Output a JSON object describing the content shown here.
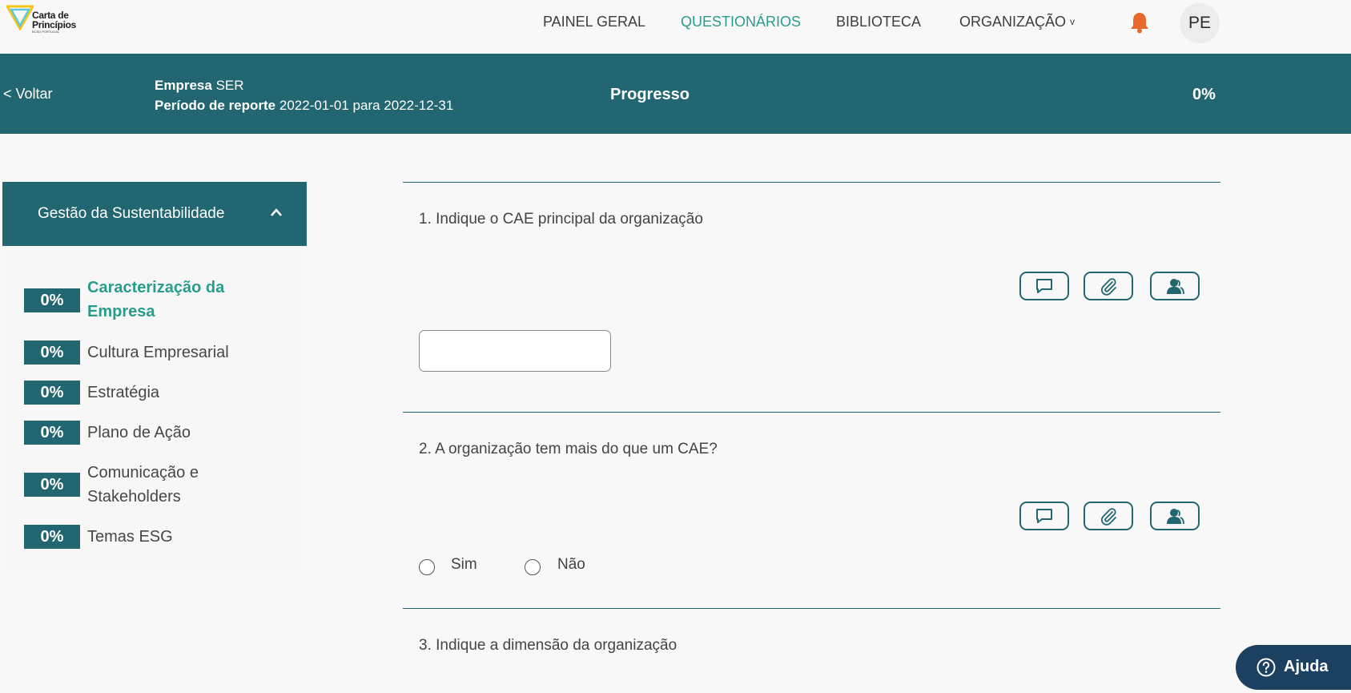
{
  "nav": {
    "logo_text": [
      "Carta de",
      "Princípios"
    ],
    "logo_sub": "BCSD PORTUGAL",
    "items": [
      {
        "label": "PAINEL GERAL"
      },
      {
        "label": "QUESTIONÁRIOS",
        "active": true
      },
      {
        "label": "BIBLIOTECA"
      },
      {
        "label": "ORGANIZAÇÃO",
        "caret": "v"
      }
    ],
    "notification_icon": "bell-icon",
    "avatar_initials": "PE"
  },
  "header": {
    "back_label": "< Voltar",
    "company_label": "Empresa",
    "company_value": "SER",
    "period_label": "Período de reporte",
    "period_value": "2022-01-01 para 2022-12-31",
    "progress_label": "Progresso",
    "progress_value": "0%"
  },
  "sidebar": {
    "section_title": "Gestão da Sustentabilidade",
    "section_icon": "chevron-up-icon",
    "items": [
      {
        "percent": "0%",
        "label": "Caracterização da Empresa",
        "active": true
      },
      {
        "percent": "0%",
        "label": "Cultura Empresarial"
      },
      {
        "percent": "0%",
        "label": "Estratégia"
      },
      {
        "percent": "0%",
        "label": "Plano de Ação"
      },
      {
        "percent": "0%",
        "label": "Comunicação e Stakeholders"
      },
      {
        "percent": "0%",
        "label": "Temas ESG"
      }
    ]
  },
  "questions": [
    {
      "text": "1. Indique o CAE principal da organização",
      "input_value": ""
    },
    {
      "text": "2. A organização tem mais do que um CAE?",
      "options": [
        "Sim",
        "Não"
      ]
    },
    {
      "text": "3. Indique a dimensão da organização"
    }
  ],
  "tool_icons": [
    "comment-icon",
    "attach-icon",
    "assign-user-icon"
  ],
  "help": {
    "label": "Ajuda",
    "icon": "question-circle-icon"
  },
  "colors": {
    "primary": "#216670",
    "accent": "#2a9d8a",
    "bell": "#e8692e",
    "help_bg": "#1c4160"
  }
}
